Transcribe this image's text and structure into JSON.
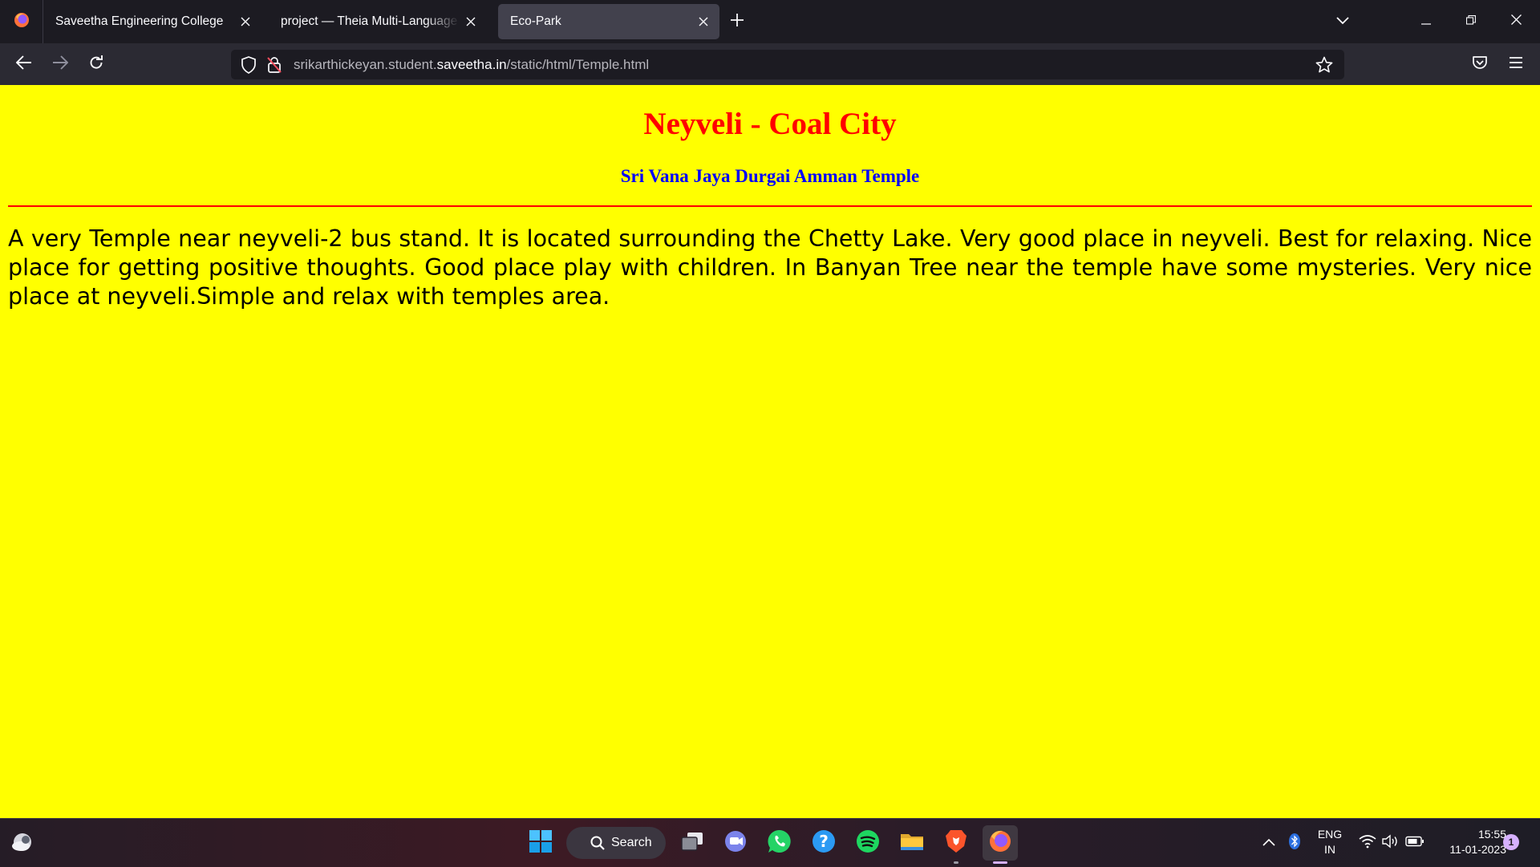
{
  "browser": {
    "tabs": [
      {
        "title": "Saveetha Engineering College",
        "active": false
      },
      {
        "title": "project — Theia Multi-Language Ex",
        "active": false
      },
      {
        "title": "Eco-Park",
        "active": true
      }
    ],
    "url": {
      "prefix": "srikarthickeyan.student.",
      "domain": "saveetha.in",
      "path": "/static/html/Temple.html"
    }
  },
  "page": {
    "heading": "Neyveli - Coal City",
    "subheading": "Sri Vana Jaya Durgai Amman Temple",
    "paragraph": "A very Temple near neyveli-2 bus stand. It is located surrounding the Chetty Lake. Very good place in neyveli. Best for relaxing. Nice place for getting positive thoughts. Good place play with children. In Banyan Tree near the temple have some mysteries. Very nice place at neyveli.Simple and relax with temples area.",
    "colors": {
      "background": "#ffff00",
      "heading": "#ff0000",
      "subheading": "#0000ff",
      "rule": "#ff0000"
    }
  },
  "taskbar": {
    "search_label": "Search",
    "apps": [
      "widgets-icon",
      "start-icon",
      "task-view-icon",
      "teams-chat-icon",
      "whatsapp-icon",
      "help-icon",
      "spotify-icon",
      "file-explorer-icon",
      "brave-icon",
      "firefox-icon"
    ],
    "tray": {
      "lang_line1": "ENG",
      "lang_line2": "IN",
      "time": "15:55",
      "date": "11-01-2023",
      "notification_count": "1"
    }
  }
}
